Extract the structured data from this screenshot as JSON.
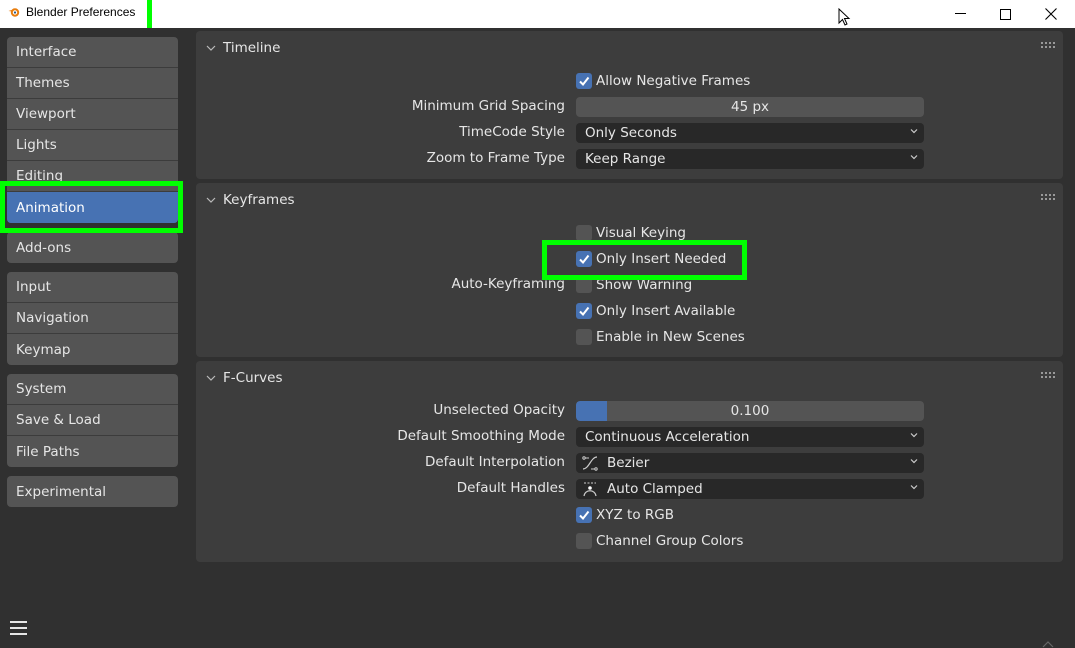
{
  "window": {
    "title": "Blender Preferences",
    "controls": {
      "minimize": "—",
      "maximize": "☐",
      "close": "✕"
    }
  },
  "sidebar": {
    "groups": [
      [
        {
          "label": "Interface"
        },
        {
          "label": "Themes"
        },
        {
          "label": "Viewport"
        },
        {
          "label": "Lights"
        },
        {
          "label": "Editing"
        },
        {
          "label": "Animation",
          "active": true
        }
      ],
      [
        {
          "label": "Add-ons"
        }
      ],
      [
        {
          "label": "Input"
        },
        {
          "label": "Navigation"
        },
        {
          "label": "Keymap"
        }
      ],
      [
        {
          "label": "System"
        },
        {
          "label": "Save & Load"
        },
        {
          "label": "File Paths"
        }
      ],
      [
        {
          "label": "Experimental"
        }
      ]
    ],
    "active": "Animation",
    "menu_icon": "hamburger-menu-icon"
  },
  "panels": {
    "timeline": {
      "title": "Timeline",
      "allow_negative_frames": {
        "label": "Allow Negative Frames",
        "checked": true
      },
      "min_grid_spacing": {
        "label": "Minimum Grid Spacing",
        "value": "45 px"
      },
      "timecode_style": {
        "label": "TimeCode Style",
        "value": "Only Seconds"
      },
      "zoom_to_frame_type": {
        "label": "Zoom to Frame Type",
        "value": "Keep Range"
      }
    },
    "keyframes": {
      "title": "Keyframes",
      "visual_keying": {
        "label": "Visual Keying",
        "checked": false
      },
      "only_insert_needed": {
        "label": "Only Insert Needed",
        "checked": true
      },
      "auto_keyframing_label": "Auto-Keyframing",
      "show_warning": {
        "label": "Show Warning",
        "checked": false
      },
      "only_insert_available": {
        "label": "Only Insert Available",
        "checked": true
      },
      "enable_in_new_scenes": {
        "label": "Enable in New Scenes",
        "checked": false
      }
    },
    "fcurves": {
      "title": "F-Curves",
      "unselected_opacity": {
        "label": "Unselected Opacity",
        "value": "0.100",
        "fraction": 0.1
      },
      "default_smoothing_mode": {
        "label": "Default Smoothing Mode",
        "value": "Continuous Acceleration"
      },
      "default_interpolation": {
        "label": "Default Interpolation",
        "value": "Bezier",
        "icon": "bezier-interpolation-icon"
      },
      "default_handles": {
        "label": "Default Handles",
        "value": "Auto Clamped",
        "icon": "auto-clamped-handle-icon"
      },
      "xyz_to_rgb": {
        "label": "XYZ to RGB",
        "checked": true
      },
      "channel_group_colors": {
        "label": "Channel Group Colors",
        "checked": false
      }
    }
  },
  "colors": {
    "accent": "#4772b3",
    "highlight": "#00ff00",
    "panel_bg": "#3d3d3d",
    "window_bg": "#303030"
  }
}
